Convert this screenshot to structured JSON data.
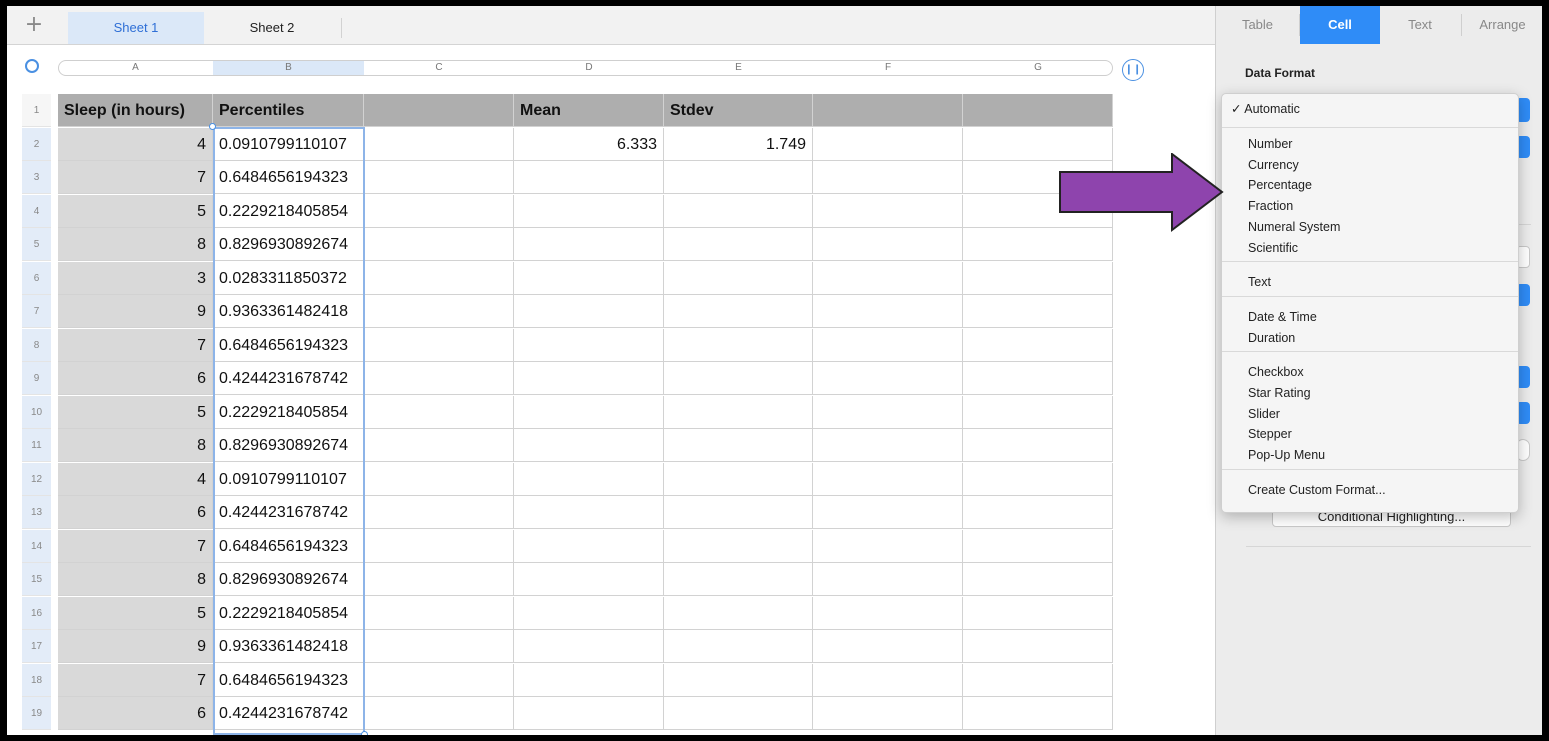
{
  "tabs": {
    "add_label": "+",
    "sheets": [
      "Sheet 1",
      "Sheet 2"
    ]
  },
  "columns": [
    "A",
    "B",
    "C",
    "D",
    "E",
    "F",
    "G"
  ],
  "table": {
    "headers": [
      "Sleep (in hours)",
      "Percentiles",
      "",
      "Mean",
      "Stdev",
      "",
      ""
    ],
    "mean_value": "6.333",
    "stdev_value": "1.749",
    "rows": [
      {
        "n": "2",
        "a": "4",
        "b": "0.0910799110107"
      },
      {
        "n": "3",
        "a": "7",
        "b": "0.6484656194323"
      },
      {
        "n": "4",
        "a": "5",
        "b": "0.2229218405854"
      },
      {
        "n": "5",
        "a": "8",
        "b": "0.8296930892674"
      },
      {
        "n": "6",
        "a": "3",
        "b": "0.0283311850372"
      },
      {
        "n": "7",
        "a": "9",
        "b": "0.9363361482418"
      },
      {
        "n": "8",
        "a": "7",
        "b": "0.6484656194323"
      },
      {
        "n": "9",
        "a": "6",
        "b": "0.4244231678742"
      },
      {
        "n": "10",
        "a": "5",
        "b": "0.2229218405854"
      },
      {
        "n": "11",
        "a": "8",
        "b": "0.8296930892674"
      },
      {
        "n": "12",
        "a": "4",
        "b": "0.0910799110107"
      },
      {
        "n": "13",
        "a": "6",
        "b": "0.4244231678742"
      },
      {
        "n": "14",
        "a": "7",
        "b": "0.6484656194323"
      },
      {
        "n": "15",
        "a": "8",
        "b": "0.8296930892674"
      },
      {
        "n": "16",
        "a": "5",
        "b": "0.2229218405854"
      },
      {
        "n": "17",
        "a": "9",
        "b": "0.9363361482418"
      },
      {
        "n": "18",
        "a": "7",
        "b": "0.6484656194323"
      },
      {
        "n": "19",
        "a": "6",
        "b": "0.4244231678742"
      }
    ]
  },
  "inspector": {
    "tabs": [
      "Table",
      "Cell",
      "Text",
      "Arrange"
    ],
    "active_tab": "Cell",
    "data_format_label": "Data Format",
    "conditional_button": "Conditional Highlighting..."
  },
  "format_menu": {
    "checked": "Automatic",
    "groups": [
      [
        "Number",
        "Currency",
        "Percentage",
        "Fraction",
        "Numeral System",
        "Scientific"
      ],
      [
        "Text"
      ],
      [
        "Date & Time",
        "Duration"
      ],
      [
        "Checkbox",
        "Star Rating",
        "Slider",
        "Stepper",
        "Pop-Up Menu"
      ],
      [
        "Create Custom Format..."
      ]
    ]
  },
  "colors": {
    "accent": "#2f8cf7",
    "header_fill": "#aeaeae",
    "header_col_fill": "#d9d9d9",
    "arrow": "#8e44ad"
  }
}
